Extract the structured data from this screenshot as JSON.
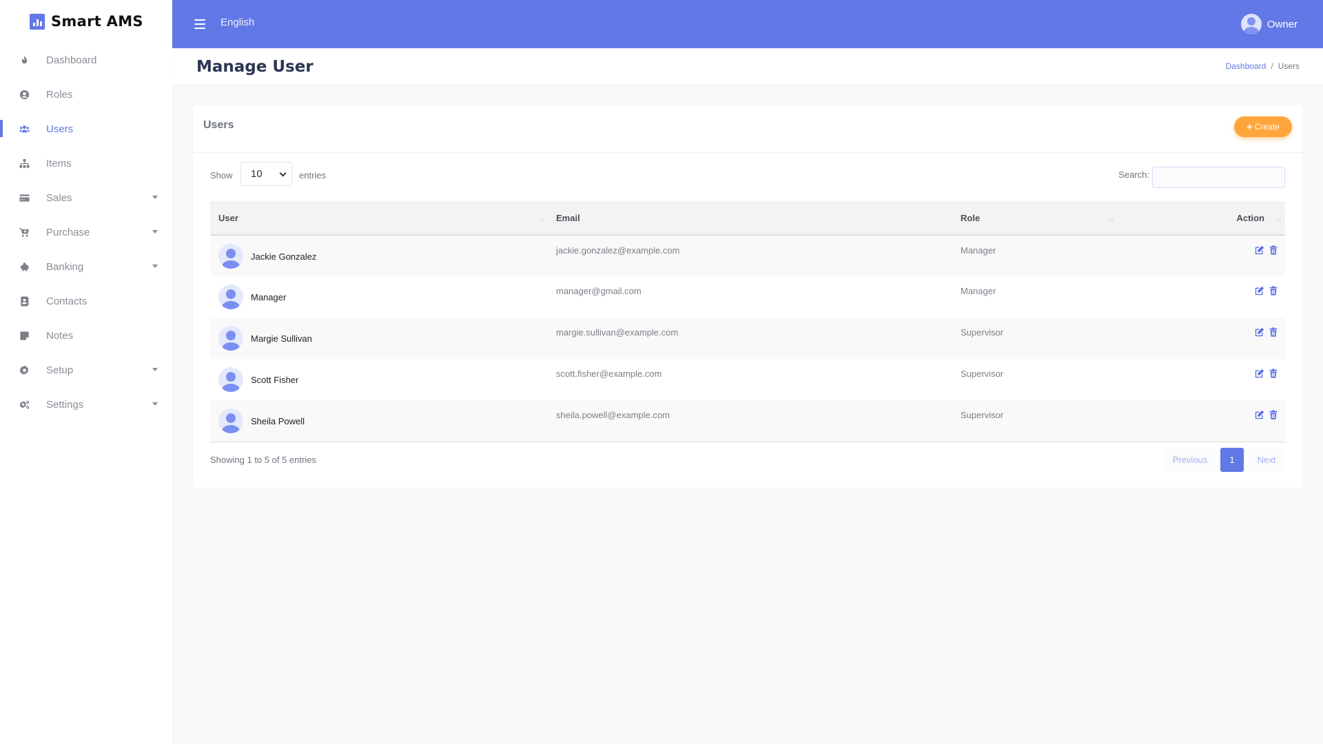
{
  "app": {
    "name": "Smart AMS",
    "accent_color": "#6278e6",
    "create_color": "#fea63b"
  },
  "sidebar": {
    "items": [
      {
        "label": "Dashboard",
        "icon": "fire-icon",
        "has_caret": false,
        "active": false
      },
      {
        "label": "Roles",
        "icon": "user-circle-icon",
        "has_caret": false,
        "active": false
      },
      {
        "label": "Users",
        "icon": "users-icon",
        "has_caret": false,
        "active": true
      },
      {
        "label": "Items",
        "icon": "sitemap-icon",
        "has_caret": false,
        "active": false
      },
      {
        "label": "Sales",
        "icon": "credit-card-icon",
        "has_caret": true,
        "active": false
      },
      {
        "label": "Purchase",
        "icon": "cart-plus-icon",
        "has_caret": true,
        "active": false
      },
      {
        "label": "Banking",
        "icon": "piggy-bank-icon",
        "has_caret": true,
        "active": false
      },
      {
        "label": "Contacts",
        "icon": "address-book-icon",
        "has_caret": false,
        "active": false
      },
      {
        "label": "Notes",
        "icon": "sticky-note-icon",
        "has_caret": false,
        "active": false
      },
      {
        "label": "Setup",
        "icon": "cog-icon",
        "has_caret": true,
        "active": false
      },
      {
        "label": "Settings",
        "icon": "cogs-icon",
        "has_caret": true,
        "active": false
      }
    ]
  },
  "header": {
    "language": "English",
    "user_name": "Owner"
  },
  "page": {
    "title": "Manage User",
    "breadcrumb": {
      "link": "Dashboard",
      "separator": "/",
      "current": "Users"
    }
  },
  "card": {
    "title": "Users",
    "create_label": "Create",
    "show_label": "Show",
    "length_value": "10",
    "entries_label": "entries",
    "search_label": "Search:",
    "search_value": "",
    "columns": [
      "User",
      "Email",
      "Role",
      "Action"
    ],
    "rows": [
      {
        "name": "Jackie Gonzalez",
        "email": "jackie.gonzalez@example.com",
        "role": "Manager"
      },
      {
        "name": "Manager",
        "email": "manager@gmail.com",
        "role": "Manager"
      },
      {
        "name": "Margie Sullivan",
        "email": "margie.sullivan@example.com",
        "role": "Supervisor"
      },
      {
        "name": "Scott Fisher",
        "email": "scott.fisher@example.com",
        "role": "Supervisor"
      },
      {
        "name": "Sheila Powell",
        "email": "sheila.powell@example.com",
        "role": "Supervisor"
      }
    ],
    "info": "Showing 1 to 5 of 5 entries",
    "pagination": {
      "previous": "Previous",
      "current": "1",
      "next": "Next"
    }
  }
}
